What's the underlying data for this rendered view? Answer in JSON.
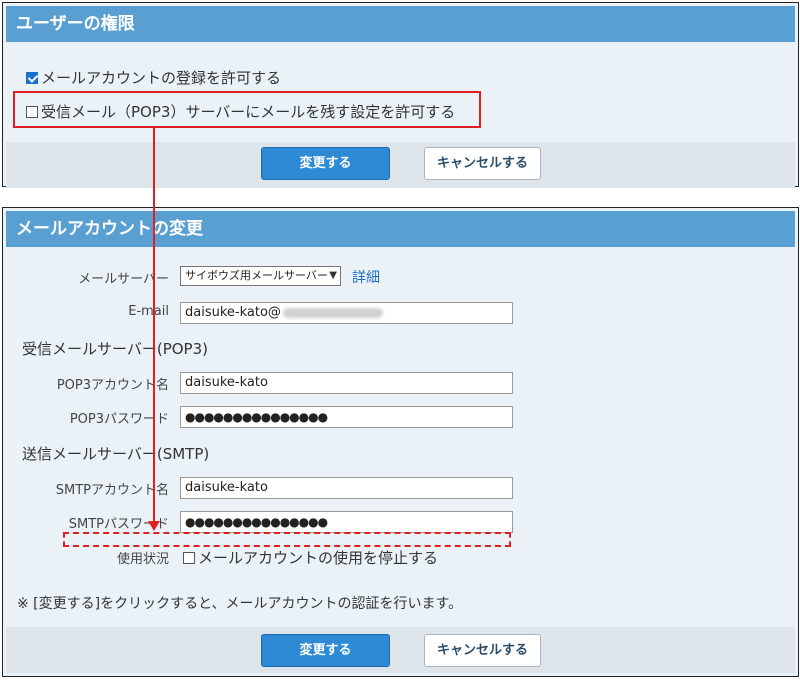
{
  "permissions_panel": {
    "title": "ユーザーの権限",
    "allow_account_registration": {
      "label": "メールアカウントの登録を許可する",
      "checked": true
    },
    "allow_leave_on_server": {
      "label": "受信メール（POP3）サーバーにメールを残す設定を許可する",
      "checked": false
    },
    "save_label": "変更する",
    "cancel_label": "キャンセルする"
  },
  "account_panel": {
    "title": "メールアカウントの変更",
    "mail_server": {
      "label": "メールサーバー",
      "selected": "サイボウズ用メールサーバー",
      "detail_link": "詳細"
    },
    "email": {
      "label": "E-mail",
      "value": "daisuke-kato@"
    },
    "incoming_section": "受信メールサーバー(POP3)",
    "pop3_account": {
      "label": "POP3アカウント名",
      "value": "daisuke-kato"
    },
    "pop3_password": {
      "label": "POP3パスワード",
      "value": "●●●●●●●●●●●●●●●"
    },
    "outgoing_section": "送信メールサーバー(SMTP)",
    "smtp_account": {
      "label": "SMTPアカウント名",
      "value": "daisuke-kato"
    },
    "smtp_password": {
      "label": "SMTPパスワード",
      "value": "●●●●●●●●●●●●●●●"
    },
    "usage_status": {
      "label": "使用状況",
      "checkbox_label": "メールアカウントの使用を停止する",
      "checked": false
    },
    "note": "※ [変更する]をクリックすると、メールアカウントの認証を行います。",
    "save_label": "変更する",
    "cancel_label": "キャンセルする"
  },
  "colors": {
    "header": "#5a9fd2",
    "panel_bg": "#eaf2f7",
    "button_primary": "#2e8ad4",
    "annotation": "#e02020"
  }
}
